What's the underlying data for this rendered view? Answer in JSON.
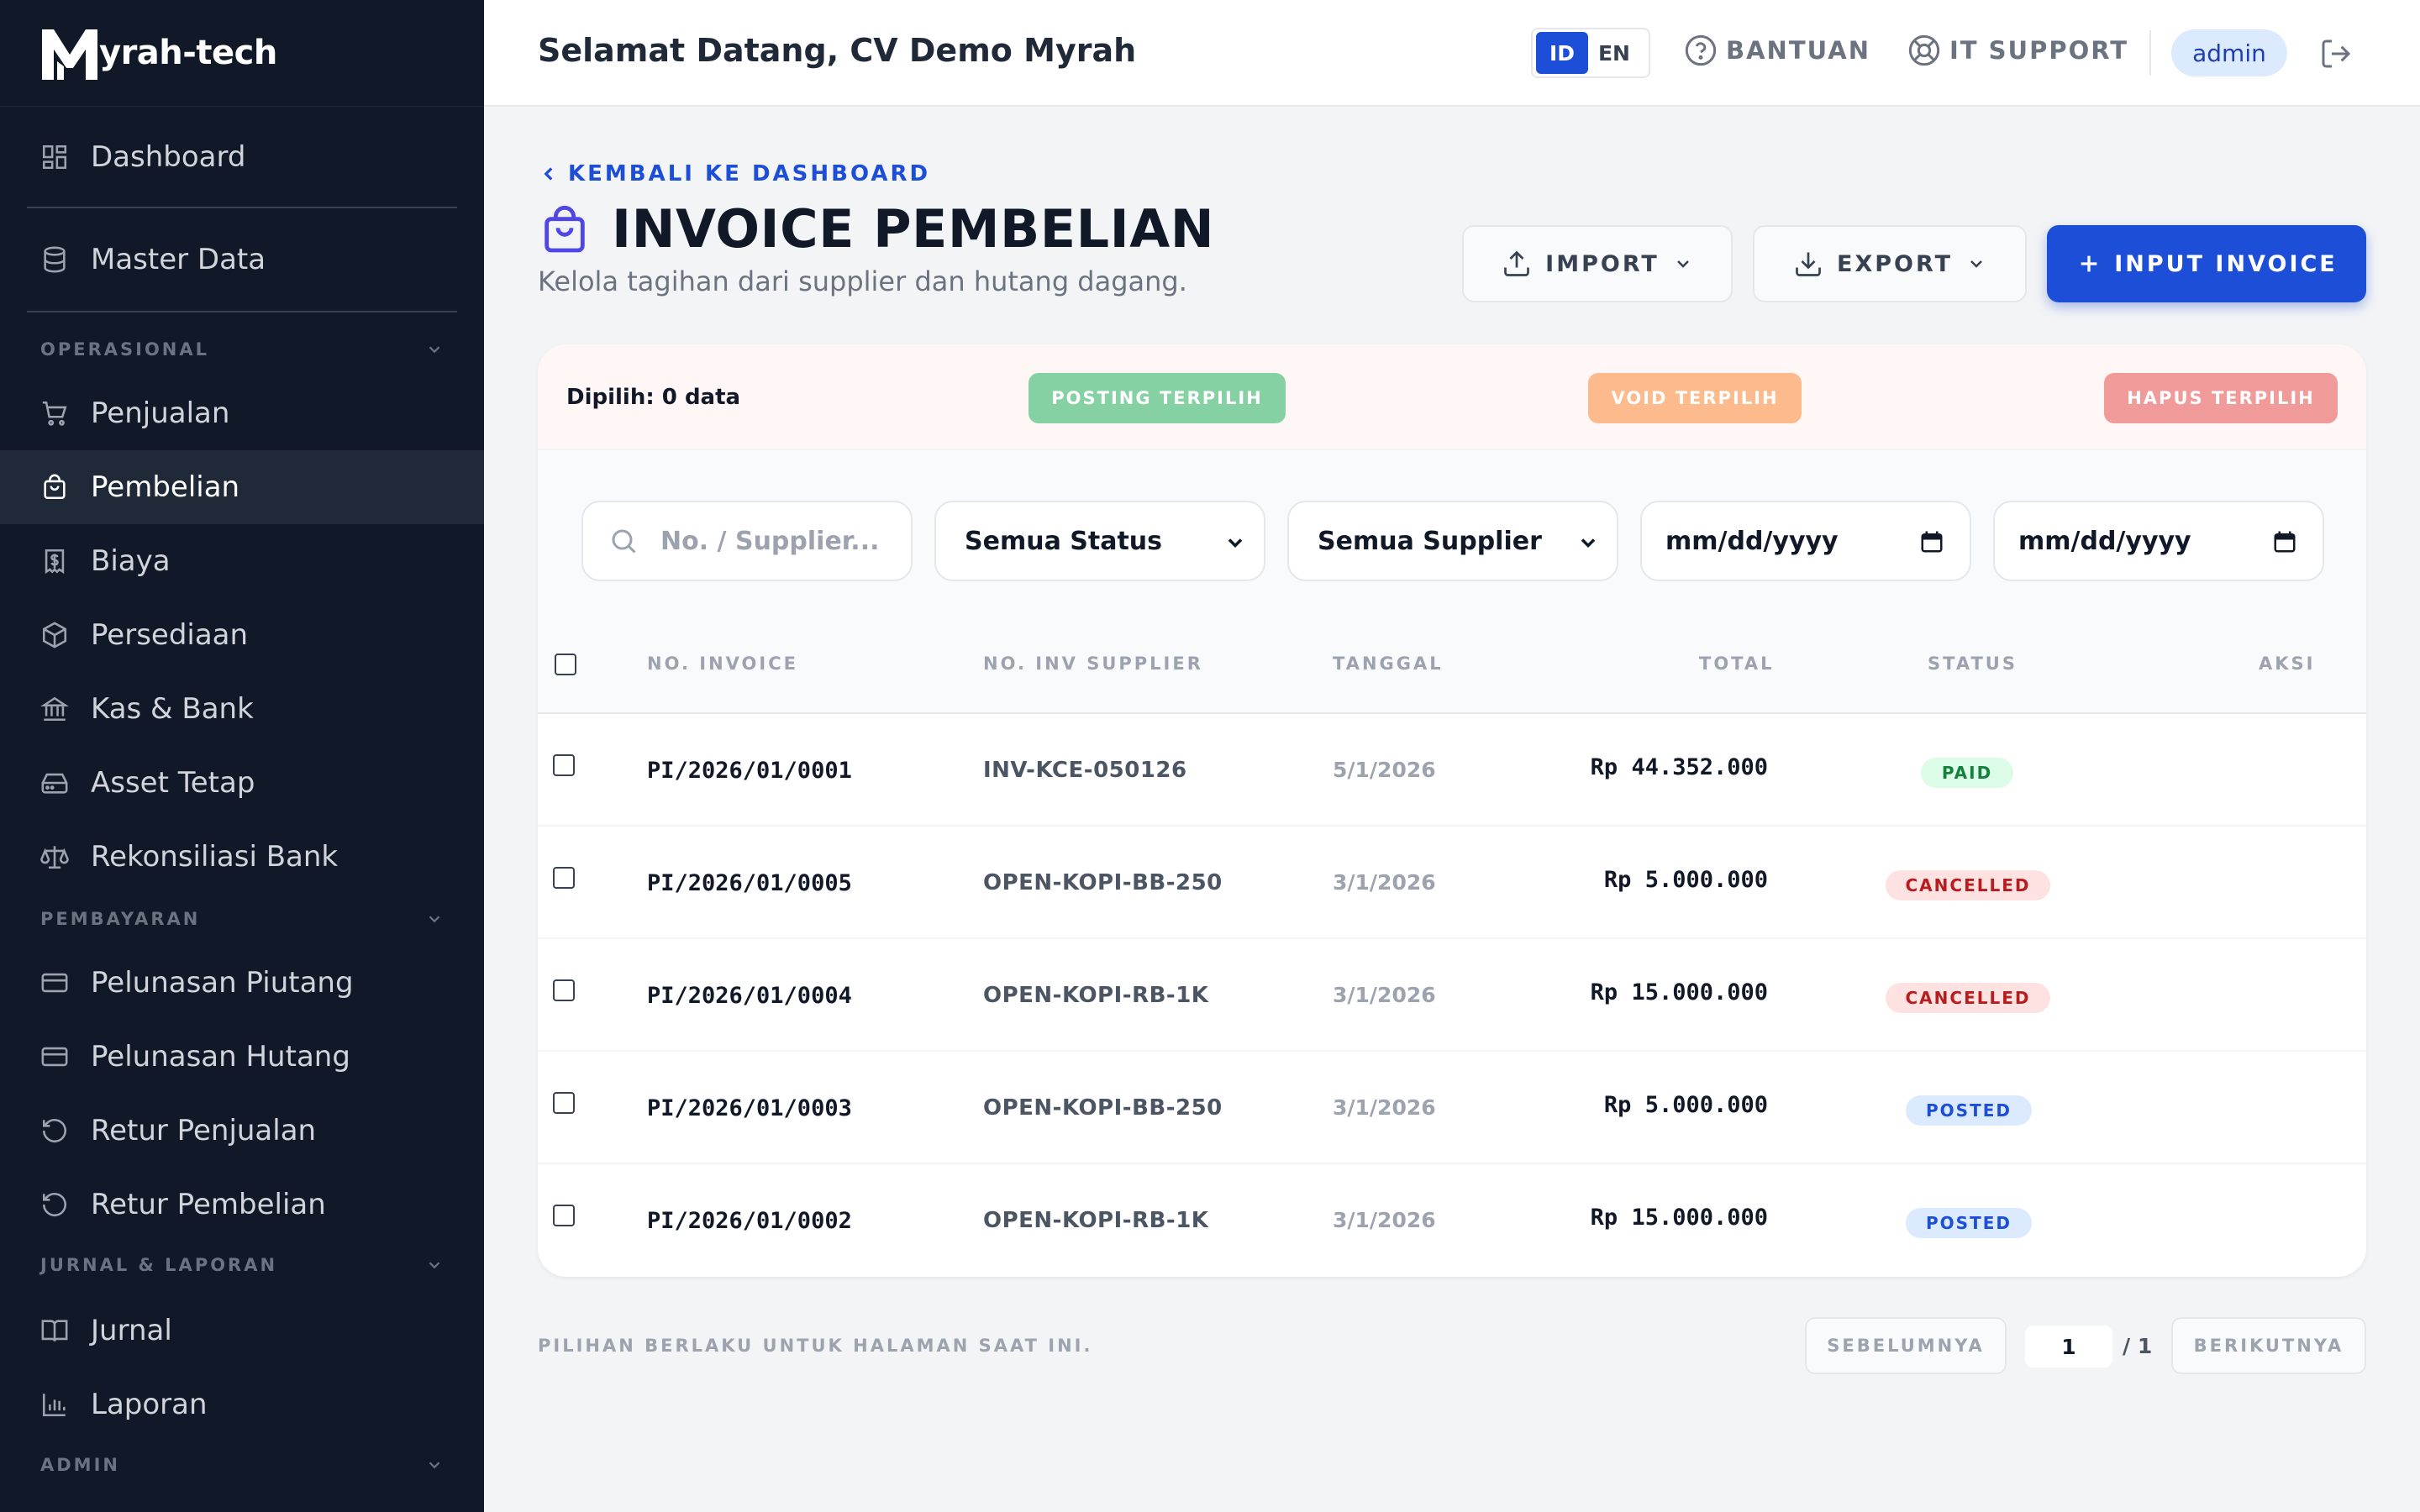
{
  "brand": {
    "logo_letter": "M",
    "name": "yrah-tech"
  },
  "sidebar": {
    "items": [
      {
        "label": "Dashboard",
        "icon": "dashboard-icon"
      },
      {
        "label": "Master Data",
        "icon": "database-icon"
      },
      {
        "label": "Penjualan",
        "icon": "cart-icon"
      },
      {
        "label": "Pembelian",
        "icon": "shopping-bag-icon",
        "active": true
      },
      {
        "label": "Biaya",
        "icon": "receipt-dollar-icon"
      },
      {
        "label": "Persediaan",
        "icon": "box-icon"
      },
      {
        "label": "Kas & Bank",
        "icon": "bank-icon"
      },
      {
        "label": "Asset Tetap",
        "icon": "hard-drive-icon"
      },
      {
        "label": "Rekonsiliasi Bank",
        "icon": "scale-icon"
      },
      {
        "label": "Pelunasan Piutang",
        "icon": "credit-card-icon"
      },
      {
        "label": "Pelunasan Hutang",
        "icon": "credit-card-icon"
      },
      {
        "label": "Retur Penjualan",
        "icon": "undo-icon"
      },
      {
        "label": "Retur Pembelian",
        "icon": "undo-icon"
      },
      {
        "label": "Jurnal",
        "icon": "book-icon"
      },
      {
        "label": "Laporan",
        "icon": "bar-chart-icon"
      }
    ],
    "sections": [
      "OPERASIONAL",
      "PEMBAYARAN",
      "JURNAL & LAPORAN",
      "ADMIN"
    ]
  },
  "header": {
    "welcome": "Selamat Datang, CV Demo Myrah",
    "lang": [
      "ID",
      "EN"
    ],
    "lang_active": "ID",
    "help": "BANTUAN",
    "support": "IT SUPPORT",
    "user": "admin"
  },
  "page": {
    "back": "KEMBALI KE DASHBOARD",
    "title": "INVOICE PEMBELIAN",
    "subtitle": "Kelola tagihan dari supplier dan hutang dagang.",
    "import": "IMPORT",
    "export": "EXPORT",
    "input": "INPUT INVOICE"
  },
  "bulk": {
    "selected": "Dipilih: 0 data",
    "post": "POSTING TERPILIH",
    "void": "VOID TERPILIH",
    "delete": "HAPUS TERPILIH"
  },
  "filters": {
    "search_placeholder": "No. / Supplier...",
    "status": "Semua Status",
    "supplier": "Semua Supplier",
    "date_from": "mm/dd/yyyy",
    "date_to": "mm/dd/yyyy"
  },
  "table": {
    "headers": [
      "NO. INVOICE",
      "NO. INV SUPPLIER",
      "TANGGAL",
      "TOTAL",
      "STATUS",
      "AKSI"
    ],
    "rows": [
      {
        "invoice": "PI/2026/01/0001",
        "supplier_inv": "INV-KCE-050126",
        "date": "5/1/2026",
        "total": "Rp 44.352.000",
        "status": "PAID"
      },
      {
        "invoice": "PI/2026/01/0005",
        "supplier_inv": "OPEN-KOPI-BB-250",
        "date": "3/1/2026",
        "total": "Rp 5.000.000",
        "status": "CANCELLED"
      },
      {
        "invoice": "PI/2026/01/0004",
        "supplier_inv": "OPEN-KOPI-RB-1K",
        "date": "3/1/2026",
        "total": "Rp 15.000.000",
        "status": "CANCELLED"
      },
      {
        "invoice": "PI/2026/01/0003",
        "supplier_inv": "OPEN-KOPI-BB-250",
        "date": "3/1/2026",
        "total": "Rp 5.000.000",
        "status": "POSTED"
      },
      {
        "invoice": "PI/2026/01/0002",
        "supplier_inv": "OPEN-KOPI-RB-1K",
        "date": "3/1/2026",
        "total": "Rp 15.000.000",
        "status": "POSTED"
      }
    ]
  },
  "footer": {
    "note": "PILIHAN BERLAKU UNTUK HALAMAN SAAT INI.",
    "prev": "SEBELUMNYA",
    "page": "1",
    "total_pages": "/ 1",
    "next": "BERIKUTNYA"
  },
  "colors": {
    "sidebar_bg": "#111827",
    "primary": "#1d4ed8",
    "paid_bg": "#dcfce7",
    "paid_fg": "#15803d",
    "cancelled_bg": "#fee2e2",
    "cancelled_fg": "#b91c1c",
    "posted_bg": "#dbeafe",
    "posted_fg": "#1d4ed8"
  }
}
